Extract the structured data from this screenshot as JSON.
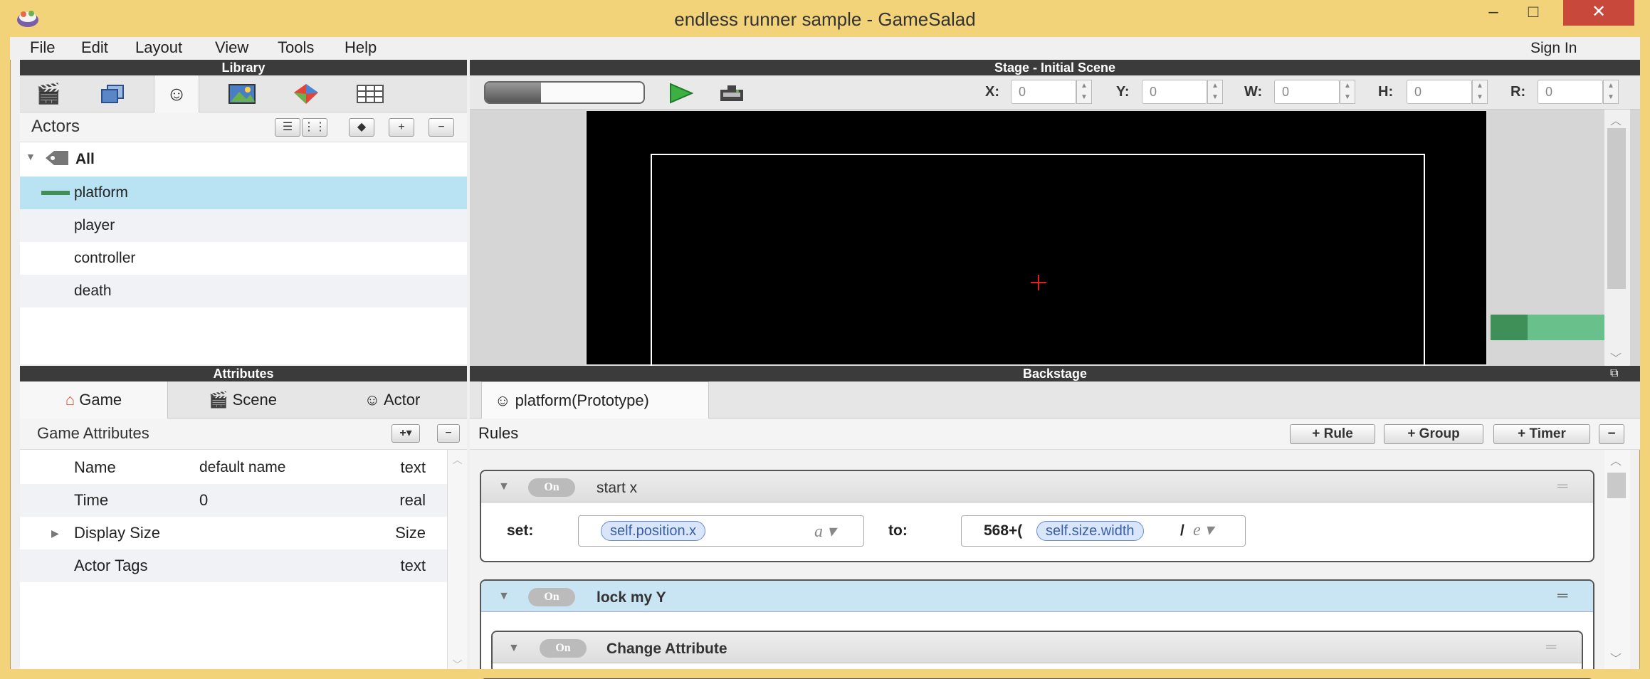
{
  "window": {
    "title": "endless runner sample - GameSalad",
    "min": "–",
    "max": "□",
    "close": "✕"
  },
  "menu": {
    "items": [
      "File",
      "Edit",
      "Layout",
      "View",
      "Tools",
      "Help"
    ],
    "sign_in": "Sign In"
  },
  "library": {
    "header": "Library",
    "actors_title": "Actors",
    "add": "+",
    "remove": "−",
    "group_all": "All",
    "actors": [
      "platform",
      "player",
      "controller",
      "death"
    ]
  },
  "stage": {
    "header": "Stage - Initial Scene",
    "progress": 0.35,
    "fields": [
      {
        "label": "X:",
        "value": "0"
      },
      {
        "label": "Y:",
        "value": "0"
      },
      {
        "label": "W:",
        "value": "0"
      },
      {
        "label": "H:",
        "value": "0"
      },
      {
        "label": "R:",
        "value": "0"
      }
    ]
  },
  "attributes": {
    "header": "Attributes",
    "tabs": [
      "Game",
      "Scene",
      "Actor"
    ],
    "section_title": "Game Attributes",
    "add": "+",
    "add_arrow": "▾",
    "remove": "−",
    "rows": [
      {
        "name": "Name",
        "value": "default name",
        "type": "text"
      },
      {
        "name": "Time",
        "value": "0",
        "type": "real"
      },
      {
        "name": "Display Size",
        "value": "",
        "type": "Size",
        "expandable": true
      },
      {
        "name": "Actor Tags",
        "value": "",
        "type": "text"
      }
    ]
  },
  "backstage": {
    "header": "Backstage",
    "tab": "platform(Prototype)",
    "rules_title": "Rules",
    "buttons": [
      "+ Rule",
      "+ Group",
      "+ Timer"
    ],
    "remove": "−",
    "on_label": "On",
    "rules": [
      {
        "title": "start x",
        "set_label": "set:",
        "target": "self.position.x",
        "to_label": "to:",
        "expr_prefix": "568+(",
        "expr_token": "self.size.width",
        "expr_suffix": "/"
      },
      {
        "title": "lock my Y"
      },
      {
        "title": "Change Attribute"
      }
    ]
  }
}
